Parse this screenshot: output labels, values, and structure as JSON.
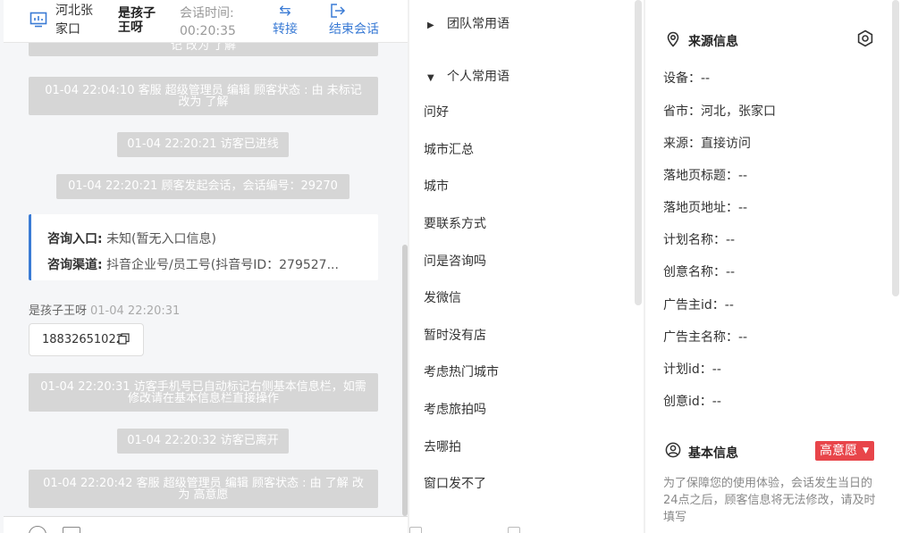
{
  "header": {
    "region": "河北张家口",
    "visitor_name": "是孩子王呀",
    "time_label": "会话时间:",
    "time_value": "00:20:35",
    "transfer_label": "转接",
    "end_label": "结束会话"
  },
  "chat": {
    "messages": [
      {
        "text": "记 改为 了解"
      },
      {
        "text": "01-04 22:04:10 客服 超级管理员 编辑 顾客状态 : 由 未标记 改为 了解"
      },
      {
        "text": "01-04 22:20:21 访客已进线"
      },
      {
        "text": "01-04 22:20:21 顾客发起会话，会话编号：29270"
      },
      {
        "text": "01-04 22:20:31 访客手机号已自动标记右侧基本信息栏，如需修改请在基本信息栏直接操作"
      },
      {
        "text": "01-04 22:20:32 访客已离开"
      },
      {
        "text": "01-04 22:20:42 客服 超级管理员 编辑 顾客状态 : 由 了解 改为 高意愿"
      }
    ],
    "card": {
      "entry_label": "咨询入口:",
      "entry_value": "未知(暂无入口信息)",
      "channel_label": "咨询渠道:",
      "channel_value": "抖音企业号/员工号(抖音号ID：279527..."
    },
    "sender_name": "是孩子王呀",
    "sender_time": "01-04 22:20:31",
    "phone": "18832651022"
  },
  "phrases": {
    "team_group": "团队常用语",
    "personal_group": "个人常用语",
    "items": [
      "问好",
      "城市汇总",
      "城市",
      "要联系方式",
      "问是咨询吗",
      "发微信",
      "暂时没有店",
      "考虑热门城市",
      "考虑旅拍吗",
      "去哪拍",
      "窗口发不了"
    ]
  },
  "info": {
    "source_title": "来源信息",
    "rows": [
      "设备：--",
      "省市：河北，张家口",
      "来源：直接访问",
      "落地页标题：--",
      "落地页地址：--",
      "计划名称：--",
      "创意名称：--",
      "广告主id：--",
      "广告主名称：--",
      "计划id：--",
      "创意id：--"
    ],
    "basic_title": "基本信息",
    "intent_badge": "高意愿",
    "notice": "为了保障您的使用体验，会话发生当日的24点之后，顾客信息将无法修改，请及时填写"
  },
  "colors": {
    "accent": "#3a7bd5",
    "badge": "#e8454a",
    "system_message": "#d6d6d6"
  }
}
